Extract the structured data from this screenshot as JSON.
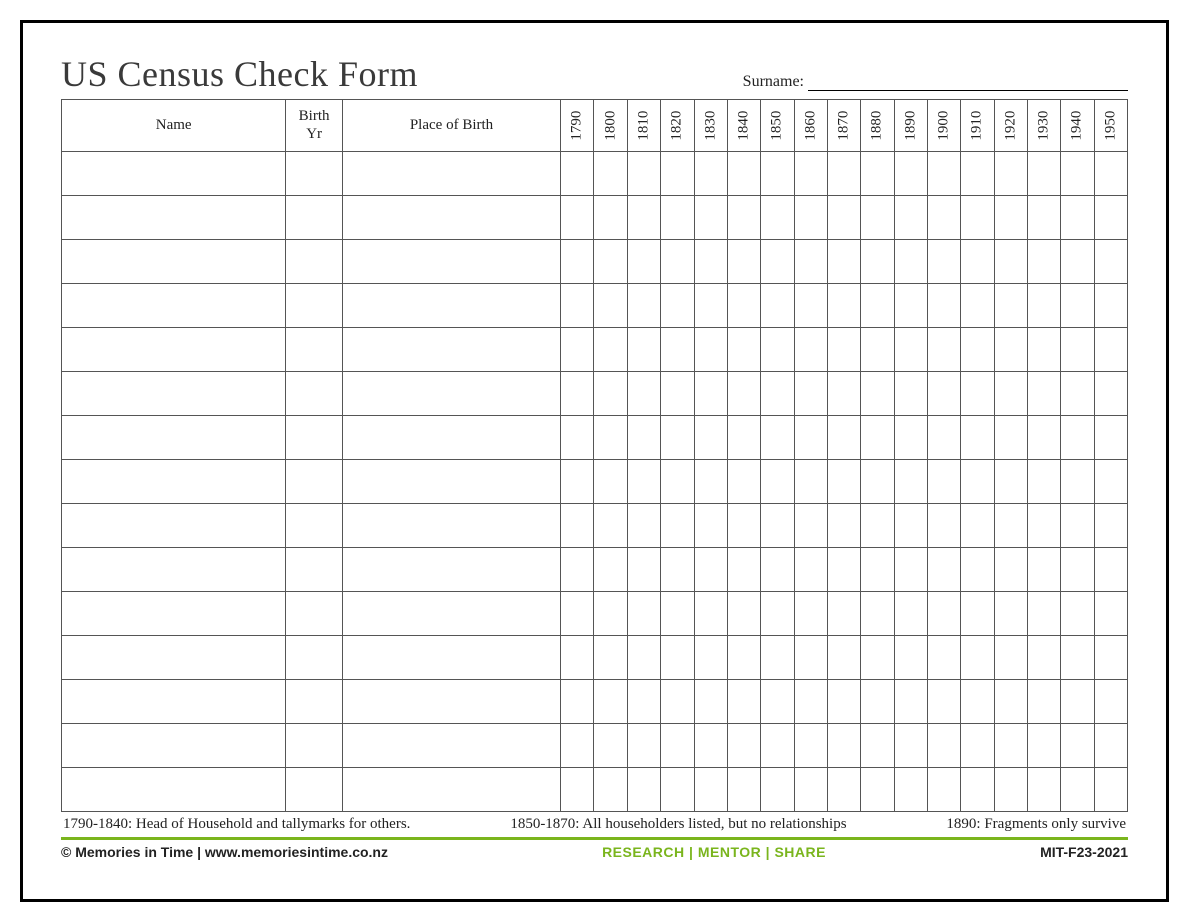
{
  "title": "US Census Check Form",
  "surname_label": "Surname:",
  "columns": {
    "name": "Name",
    "birth_yr": "Birth\nYr",
    "place_of_birth": "Place of Birth"
  },
  "years": [
    "1790",
    "1800",
    "1810",
    "1820",
    "1830",
    "1840",
    "1850",
    "1860",
    "1870",
    "1880",
    "1890",
    "1900",
    "1910",
    "1920",
    "1930",
    "1940",
    "1950"
  ],
  "row_count": 15,
  "notes": {
    "left": "1790-1840: Head of Household and tallymarks for others.",
    "center": "1850-1870: All householders listed, but no relationships",
    "right": "1890: Fragments only survive"
  },
  "footer": {
    "copyright": "© Memories in Time | www.memoriesintime.co.nz",
    "tagline_research": "RESEARCH",
    "tagline_mentor": "MENTOR",
    "tagline_share": "SHARE",
    "tagline_sep": "  |  ",
    "code": "MIT-F23-2021"
  }
}
